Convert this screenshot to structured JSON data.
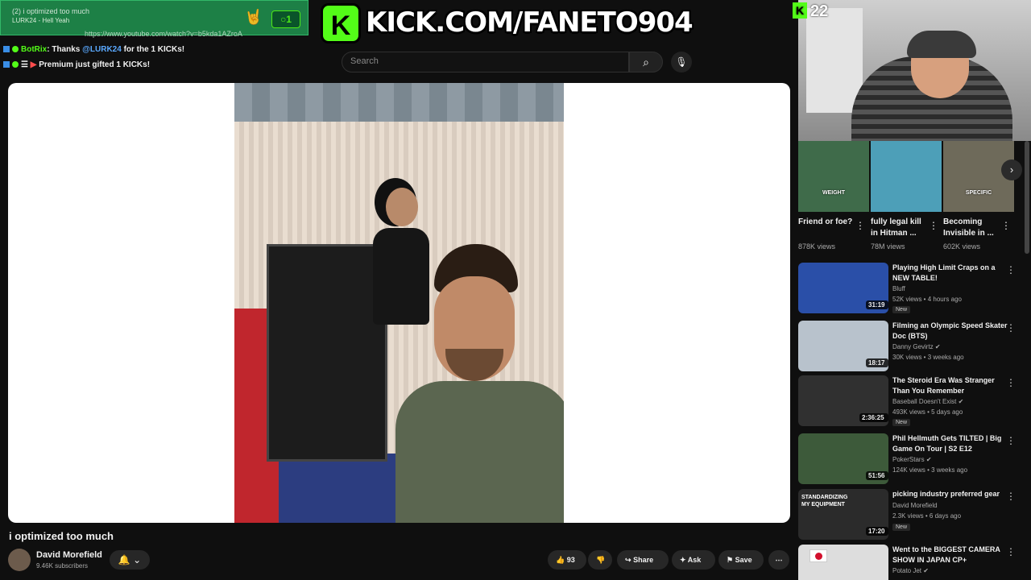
{
  "overlay": {
    "browser_tab_title": "(2) i optimized too much",
    "browser_url": "https://www.youtube.com/watch?v=b5kda1AZroA",
    "chat_peek_user": "LURK24",
    "chat_peek_text": "- Hell Yeah",
    "counter_label": "1",
    "kick_letter": "K",
    "kick_url": "KICK.COM/FANETO904",
    "viewer_count": "22",
    "chat": [
      {
        "user": "BotRix",
        "text_before": ": Thanks ",
        "mention": "@LURK24",
        "text_after": " for the 1 KICKs!"
      },
      {
        "user": "Premium",
        "text_before": "",
        "mention": "",
        "text_after": " just gifted 1 KICKs!"
      }
    ]
  },
  "search": {
    "placeholder": "Search"
  },
  "video": {
    "title": "i optimized too much",
    "channel": "David Morefield",
    "subscribers": "9.46K subscribers",
    "likes": "93",
    "share_label": "Share",
    "ask_label": "Ask",
    "save_label": "Save"
  },
  "shorts": [
    {
      "title": "Friend or foe?",
      "views": "878K views",
      "overlay": "WEIGHT",
      "color": "#3f6b4a"
    },
    {
      "title": "fully legal kill in Hitman ...",
      "views": "78M views",
      "overlay": "",
      "color": "#4d9fb8"
    },
    {
      "title": "Becoming Invisible in ...",
      "views": "602K views",
      "overlay": "SPECIFIC",
      "color": "#6e6a5a"
    }
  ],
  "recommended": [
    {
      "title": "Playing High Limit Craps on a NEW TABLE!",
      "channel": "Bluff",
      "meta": "52K views • 4 hours ago",
      "duration": "31:19",
      "new": "New",
      "color": "#2a4fa8",
      "overlay": ""
    },
    {
      "title": "Filming an Olympic Speed Skater Doc (BTS)",
      "channel": "Danny Gevirtz",
      "meta": "30K views • 3 weeks ago",
      "duration": "18:17",
      "new": "",
      "color": "#b8c2cc",
      "overlay": ""
    },
    {
      "title": "The Steroid Era Was Stranger Than You Remember",
      "channel": "Baseball Doesn't Exist",
      "meta": "493K views • 5 days ago",
      "duration": "2:36:25",
      "new": "New",
      "color": "#303030",
      "overlay": ""
    },
    {
      "title": "Phil Hellmuth Gets TILTED | Big Game On Tour | S2 E12",
      "channel": "PokerStars",
      "meta": "124K views • 3 weeks ago",
      "duration": "51:56",
      "new": "",
      "color": "#3d5a3a",
      "overlay": ""
    },
    {
      "title": "picking industry preferred gear",
      "channel": "David Morefield",
      "meta": "2.3K views • 6 days ago",
      "duration": "17:20",
      "new": "New",
      "color": "#2b2b2b",
      "overlay": "STANDARDIZING MY EQUIPMENT"
    },
    {
      "title": "Went to the BIGGEST CAMERA SHOW IN JAPAN CP+",
      "channel": "Potato Jet",
      "meta": "",
      "duration": "",
      "new": "",
      "color": "#ddd",
      "overlay": ""
    }
  ]
}
